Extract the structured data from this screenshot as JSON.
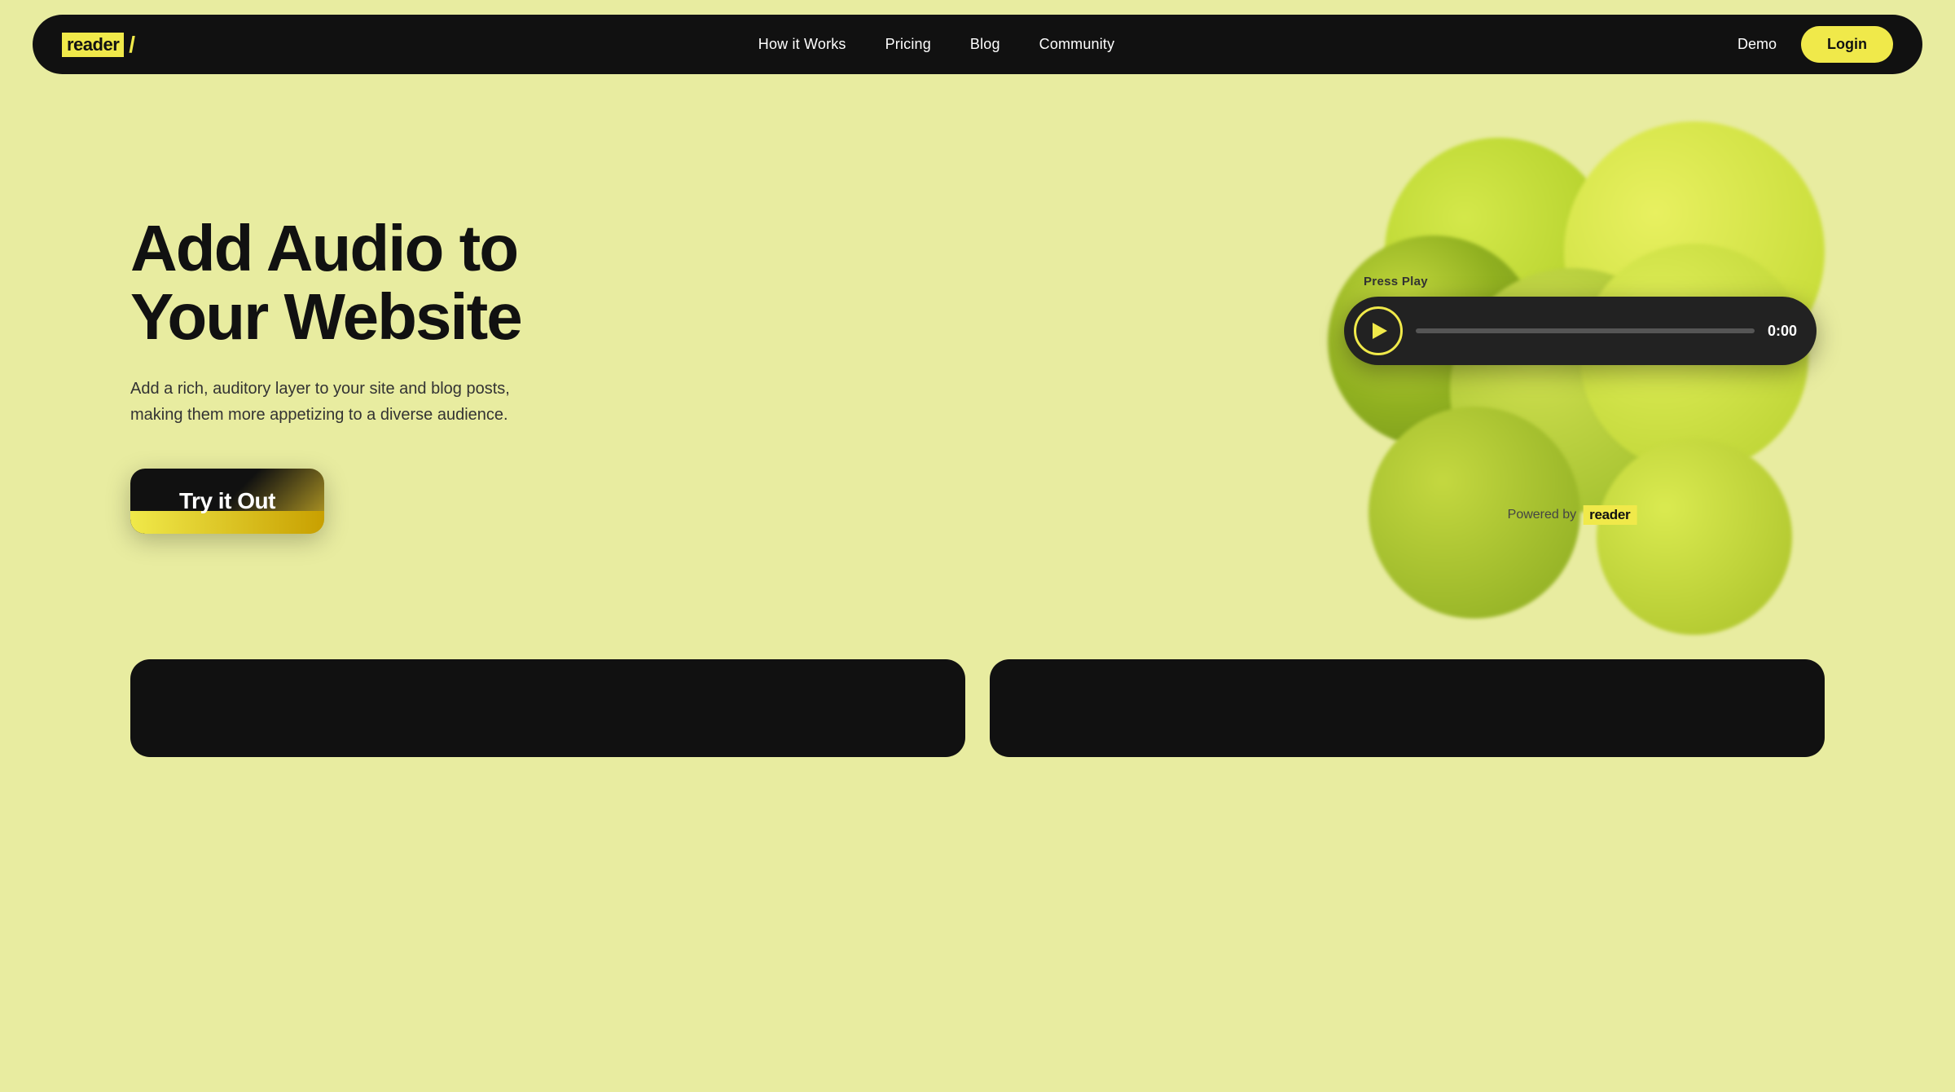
{
  "nav": {
    "logo_text": "reader",
    "logo_slash": "/",
    "links": [
      {
        "label": "How it Works",
        "href": "#"
      },
      {
        "label": "Pricing",
        "href": "#"
      },
      {
        "label": "Blog",
        "href": "#"
      },
      {
        "label": "Community",
        "href": "#"
      }
    ],
    "demo_label": "Demo",
    "login_label": "Login"
  },
  "hero": {
    "title_line1": "Add Audio to",
    "title_line2": "Your Website",
    "subtitle": "Add a rich, auditory layer to your site and blog posts, making them more appetizing to a diverse audience.",
    "cta_label": "Try it Out",
    "press_play": "Press Play",
    "time": "0:00",
    "powered_text": "Powered by",
    "powered_logo": "reader"
  },
  "colors": {
    "brand_yellow": "#f0e94a",
    "nav_bg": "#111111",
    "page_bg": "#e8eca0"
  }
}
